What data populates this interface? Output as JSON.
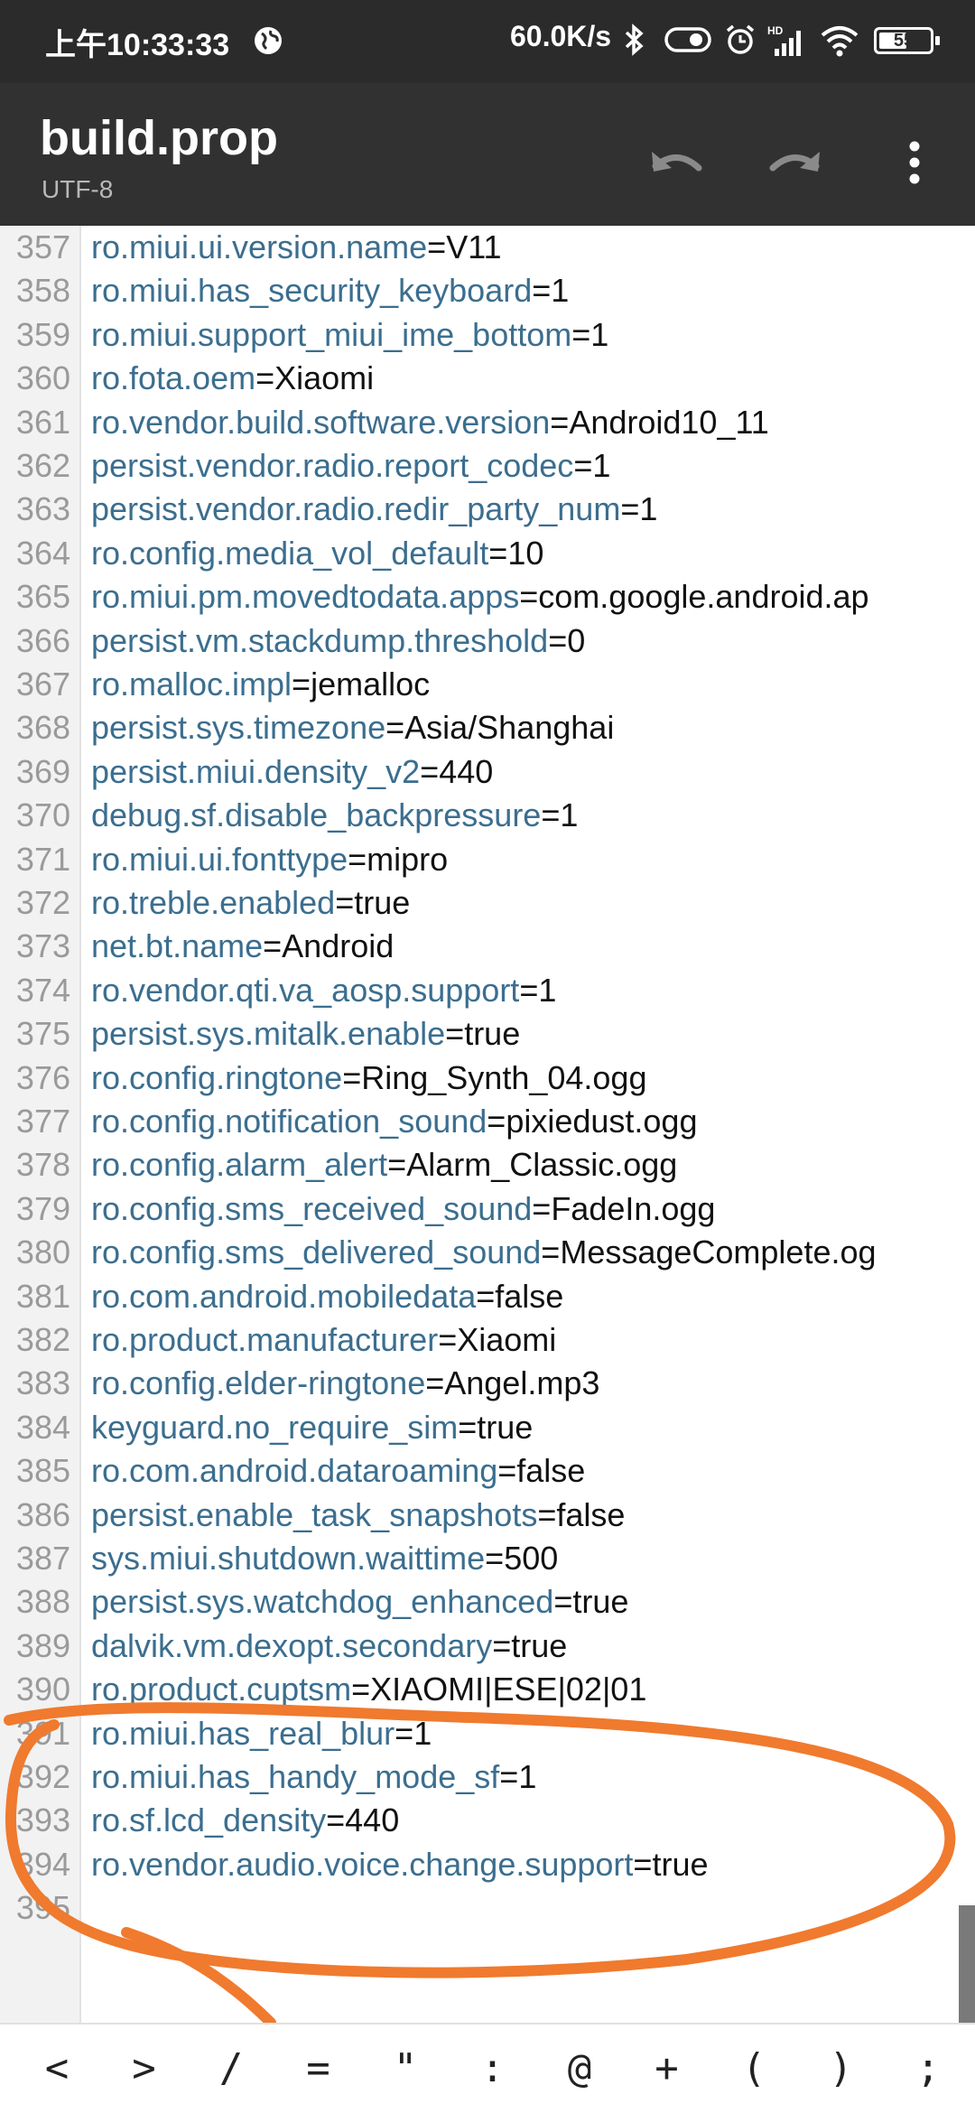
{
  "status_bar": {
    "time": "上午10:33:33",
    "net_speed": "60.0K/s",
    "battery_level": "55",
    "icons": [
      "globe-icon",
      "bluetooth-icon",
      "toggle-icon",
      "alarm-icon",
      "hd-signal-icon",
      "wifi-icon",
      "battery-icon"
    ]
  },
  "toolbar": {
    "title": "build.prop",
    "subtitle": "UTF-8",
    "icons": [
      "undo-icon",
      "redo-icon",
      "more-vertical-icon"
    ]
  },
  "editor": {
    "lines": [
      {
        "num": "357",
        "key": "ro.miui.ui.version.name",
        "eq": "=",
        "value": "V11"
      },
      {
        "num": "358",
        "key": "ro.miui.has_security_keyboard",
        "eq": "=",
        "value": "1"
      },
      {
        "num": "359",
        "key": "ro.miui.support_miui_ime_bottom",
        "eq": "=",
        "value": "1"
      },
      {
        "num": "360",
        "key": "ro.fota.oem",
        "eq": "=",
        "value": "Xiaomi"
      },
      {
        "num": "361",
        "key": "ro.vendor.build.software.version",
        "eq": "=",
        "value": "Android10_11"
      },
      {
        "num": "362",
        "key": "persist.vendor.radio.report_codec",
        "eq": "=",
        "value": "1"
      },
      {
        "num": "363",
        "key": "persist.vendor.radio.redir_party_num",
        "eq": "=",
        "value": "1"
      },
      {
        "num": "364",
        "key": "ro.config.media_vol_default",
        "eq": "=",
        "value": "10"
      },
      {
        "num": "365",
        "key": "ro.miui.pm.movedtodata.apps",
        "eq": "=",
        "value": "com.google.android.ap"
      },
      {
        "num": "366",
        "key": "persist.vm.stackdump.threshold",
        "eq": "=",
        "value": "0"
      },
      {
        "num": "367",
        "key": "ro.malloc.impl",
        "eq": "=",
        "value": "jemalloc"
      },
      {
        "num": "368",
        "key": "persist.sys.timezone",
        "eq": "=",
        "value": "Asia/Shanghai"
      },
      {
        "num": "369",
        "key": "persist.miui.density_v2",
        "eq": "=",
        "value": "440"
      },
      {
        "num": "370",
        "key": "debug.sf.disable_backpressure",
        "eq": "=",
        "value": "1"
      },
      {
        "num": "371",
        "key": "ro.miui.ui.fonttype",
        "eq": "=",
        "value": "mipro"
      },
      {
        "num": "372",
        "key": "ro.treble.enabled",
        "eq": "=",
        "value": "true"
      },
      {
        "num": "373",
        "key": "net.bt.name",
        "eq": "=",
        "value": "Android"
      },
      {
        "num": "374",
        "key": "ro.vendor.qti.va_aosp.support",
        "eq": "=",
        "value": "1"
      },
      {
        "num": "375",
        "key": "persist.sys.mitalk.enable",
        "eq": "=",
        "value": "true"
      },
      {
        "num": "376",
        "key": "ro.config.ringtone",
        "eq": "=",
        "value": "Ring_Synth_04.ogg"
      },
      {
        "num": "377",
        "key": "ro.config.notification_sound",
        "eq": "=",
        "value": "pixiedust.ogg"
      },
      {
        "num": "378",
        "key": "ro.config.alarm_alert",
        "eq": "=",
        "value": "Alarm_Classic.ogg"
      },
      {
        "num": "379",
        "key": "ro.config.sms_received_sound",
        "eq": "=",
        "value": "FadeIn.ogg"
      },
      {
        "num": "380",
        "key": "ro.config.sms_delivered_sound",
        "eq": "=",
        "value": "MessageComplete.og"
      },
      {
        "num": "381",
        "key": "ro.com.android.mobiledata",
        "eq": "=",
        "value": "false"
      },
      {
        "num": "382",
        "key": "ro.product.manufacturer",
        "eq": "=",
        "value": "Xiaomi"
      },
      {
        "num": "383",
        "key": "ro.config.elder-ringtone",
        "eq": "=",
        "value": "Angel.mp3"
      },
      {
        "num": "384",
        "key": "keyguard.no_require_sim",
        "eq": "=",
        "value": "true"
      },
      {
        "num": "385",
        "key": "ro.com.android.dataroaming",
        "eq": "=",
        "value": "false"
      },
      {
        "num": "386",
        "key": "persist.enable_task_snapshots",
        "eq": "=",
        "value": "false"
      },
      {
        "num": "387",
        "key": "sys.miui.shutdown.waittime",
        "eq": "=",
        "value": "500"
      },
      {
        "num": "388",
        "key": "persist.sys.watchdog_enhanced",
        "eq": "=",
        "value": "true"
      },
      {
        "num": "389",
        "key": "dalvik.vm.dexopt.secondary",
        "eq": "=",
        "value": "true"
      },
      {
        "num": "390",
        "key": "ro.product.cuptsm",
        "eq": "=",
        "value": "XIAOMI|ESE|02|01"
      },
      {
        "num": "391",
        "key": "ro.miui.has_real_blur",
        "eq": "=",
        "value": "1"
      },
      {
        "num": "392",
        "key": "ro.miui.has_handy_mode_sf",
        "eq": "=",
        "value": "1"
      },
      {
        "num": "393",
        "key": "ro.sf.lcd_density",
        "eq": "=",
        "value": "440"
      },
      {
        "num": "394",
        "key": "ro.vendor.audio.voice.change.support",
        "eq": "=",
        "value": "true"
      },
      {
        "num": "395",
        "key": "",
        "eq": "",
        "value": ""
      }
    ]
  },
  "symbol_bar": {
    "symbols": [
      "<",
      ">",
      "/",
      "=",
      "\"",
      ":",
      "@",
      "+",
      "(",
      ")",
      ";"
    ]
  },
  "colors": {
    "status_bar_bg": "#2b2b2b",
    "toolbar_bg": "#313131",
    "key_text": "#3b6e8f",
    "value_text": "#111111",
    "line_number": "#9a9a9a",
    "annotation": "#f07a2e"
  }
}
